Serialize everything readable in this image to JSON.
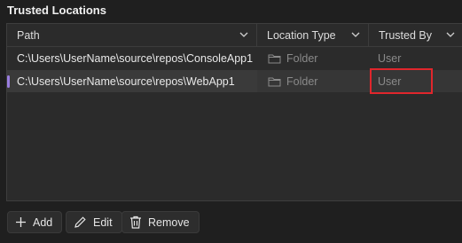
{
  "panel": {
    "title": "Trusted Locations"
  },
  "table": {
    "columns": [
      {
        "label": "Path"
      },
      {
        "label": "Location Type"
      },
      {
        "label": "Trusted By"
      }
    ],
    "rows": [
      {
        "path": "C:\\Users\\UserName\\source\\repos\\ConsoleApp1",
        "type": "Folder",
        "trusted_by": "User"
      },
      {
        "path": "C:\\Users\\UserName\\source\\repos\\WebApp1",
        "type": "Folder",
        "trusted_by": "User"
      }
    ]
  },
  "buttons": {
    "add": "Add",
    "edit": "Edit",
    "remove": "Remove"
  },
  "icons": {
    "column_menu": "chevron-down-icon",
    "folder": "folder-icon",
    "add": "plus-icon",
    "edit": "pencil-icon",
    "remove": "trash-icon"
  },
  "colors": {
    "selection_marker": "#9a7ee0",
    "highlight_box": "#e0262c"
  }
}
